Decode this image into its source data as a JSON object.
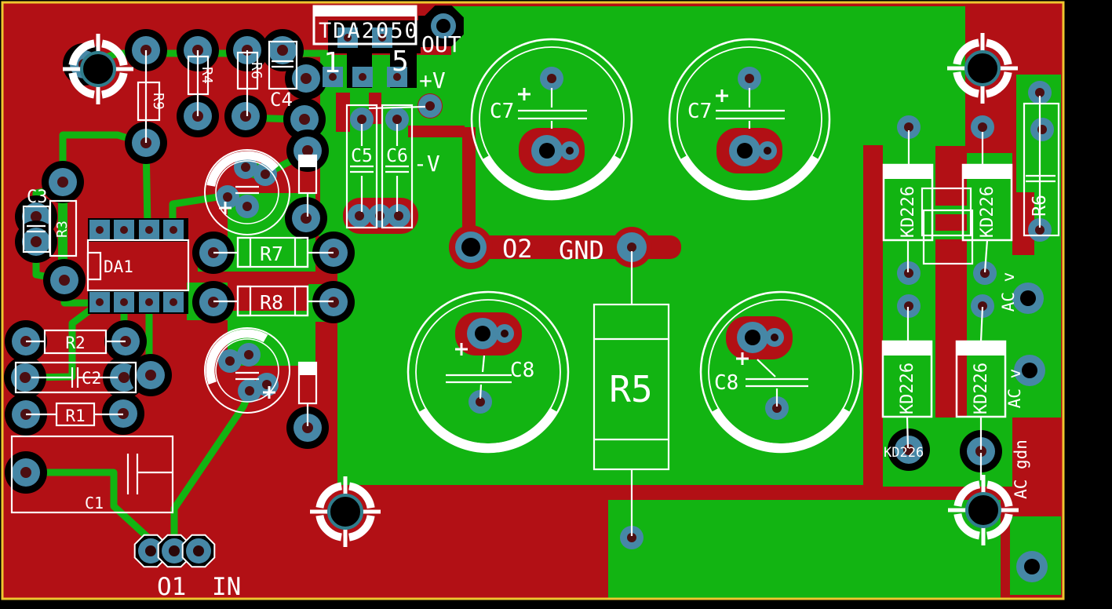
{
  "board": {
    "ic": {
      "label": "TDA2050",
      "pin_first": "1",
      "pin_last": "5"
    },
    "power": {
      "out": "OUT",
      "v_plus": "+V",
      "v_minus": "-V",
      "o2": "O2",
      "gnd": "GND",
      "o1_in": "O1 IN",
      "ac_v_top": "AC v",
      "ac_v_bottom": "AC v",
      "ac_gnd": "AC gdn"
    },
    "components": {
      "c1": "C1",
      "c2": "C2",
      "c3": "C3",
      "c4": "C4",
      "c5": "C5",
      "c6": "C6",
      "c7_left": "C7",
      "c7_right": "C7",
      "c8_left": "C8",
      "c8_right": "C8",
      "r1": "R1",
      "r2": "R2",
      "r3": "R3",
      "r4": "R4",
      "r5": "R5",
      "r6_top": "R6",
      "r6_right": "R6",
      "r7": "R7",
      "r8": "R8",
      "r9": "R9",
      "da1": "DA1",
      "d1": "KD226",
      "d2": "KD226",
      "d3": "KD226",
      "d4": "KD226",
      "diode_note": "KD226"
    },
    "colors": {
      "copper_red": "#b21015",
      "trace_green": "#12b412",
      "pad_blue": "#4687a6",
      "silkscreen": "#ffffff",
      "border_yellow": "#eec62f",
      "hole_ring_teal": "#2f7d8c"
    }
  }
}
